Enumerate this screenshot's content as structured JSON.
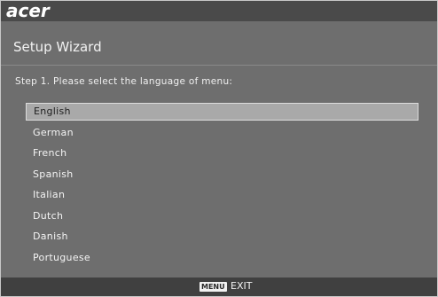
{
  "header": {
    "logo_text": "acer"
  },
  "wizard": {
    "title": "Setup Wizard",
    "step_text": "Step 1. Please select the language of menu:",
    "selected_index": 0,
    "languages": [
      "English",
      "German",
      "French",
      "Spanish",
      "Italian",
      "Dutch",
      "Danish",
      "Portuguese"
    ]
  },
  "footer": {
    "menu_key": "MENU",
    "exit_label": "EXIT"
  },
  "colors": {
    "background": "#6e6e6e",
    "topbar": "#4a4a4a",
    "selection": "#a9a9a9",
    "bottombar": "#404040"
  }
}
